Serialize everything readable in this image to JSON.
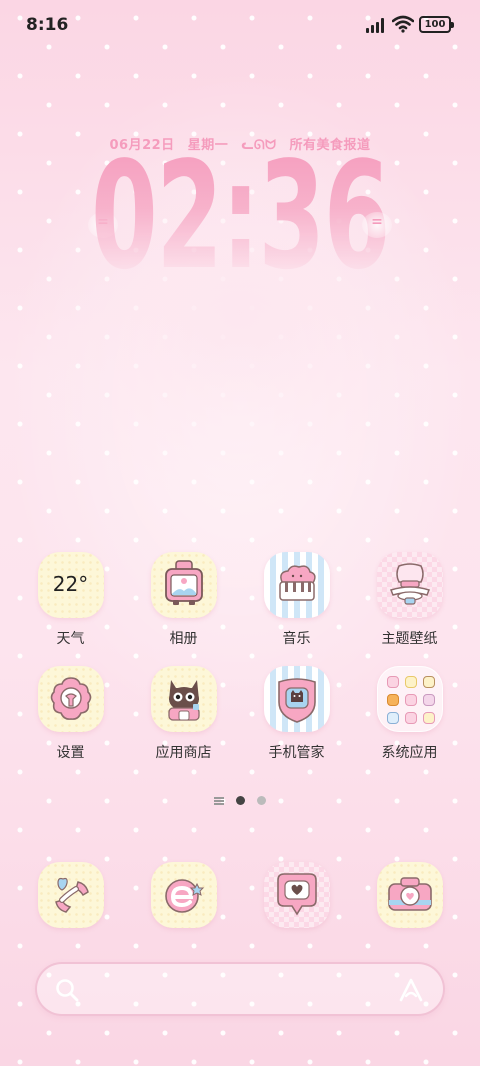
{
  "status_bar": {
    "time": "8:16",
    "battery": "100"
  },
  "clock_widget": {
    "date": "06月22日",
    "weekday": "星期一",
    "emoticon": "ᓚᘏᗢ",
    "message": "所有美食报道",
    "time": "02:36"
  },
  "apps": [
    {
      "label": "天气",
      "icon": "weather-icon",
      "temp": "22°"
    },
    {
      "label": "相册",
      "icon": "gallery-icon"
    },
    {
      "label": "音乐",
      "icon": "music-icon"
    },
    {
      "label": "主题壁纸",
      "icon": "theme-icon"
    },
    {
      "label": "设置",
      "icon": "settings-icon"
    },
    {
      "label": "应用商店",
      "icon": "app-store-icon"
    },
    {
      "label": "手机管家",
      "icon": "phone-manager-icon"
    },
    {
      "label": "系统应用",
      "icon": "system-apps-folder-icon"
    }
  ],
  "page_indicator": {
    "pages": 2,
    "current": 1
  },
  "dock": [
    {
      "icon": "phone-icon"
    },
    {
      "icon": "browser-icon"
    },
    {
      "icon": "messages-icon"
    },
    {
      "icon": "camera-icon"
    }
  ],
  "search": {
    "placeholder": ""
  },
  "colors": {
    "accent_pink": "#f59cbd",
    "background": "#fbdde8",
    "icon_pink": "#f7a7c3",
    "icon_blue": "#a8d4f0"
  }
}
